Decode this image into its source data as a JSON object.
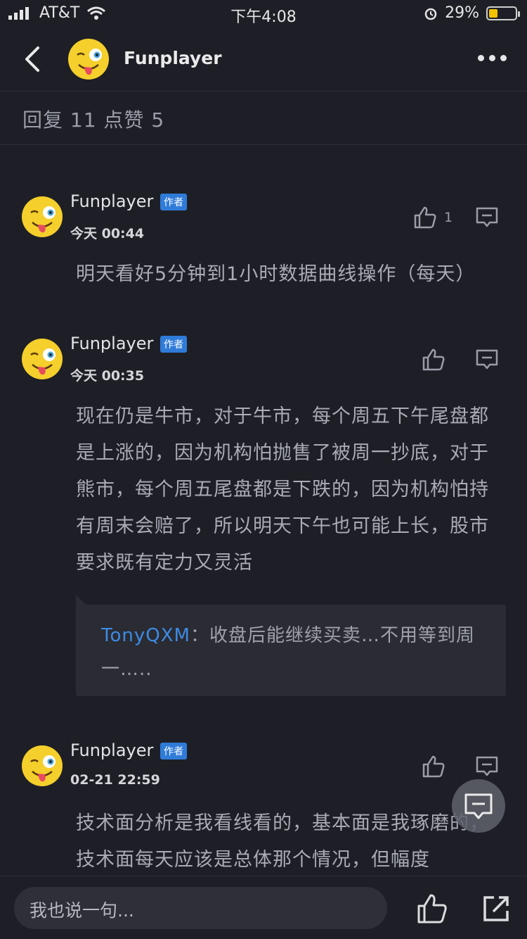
{
  "status_bar": {
    "carrier": "AT&T",
    "time": "下午4:08",
    "battery": "29%"
  },
  "nav": {
    "title": "Funplayer"
  },
  "stats": {
    "text": "回复 11  点赞 5"
  },
  "posts": [
    {
      "author": "Funplayer",
      "badge": "作者",
      "time": "今天 00:44",
      "likes": "1",
      "content": "明天看好5分钟到1小时数据曲线操作（每天）"
    },
    {
      "author": "Funplayer",
      "badge": "作者",
      "time": "今天 00:35",
      "likes": "",
      "content": "现在仍是牛市，对于牛市，每个周五下午尾盘都是上涨的，因为机构怕抛售了被周一抄底，对于熊市，每个周五尾盘都是下跌的，因为机构怕持有周末会赔了，所以明天下午也可能上长，股市要求既有定力又灵活",
      "quote": {
        "user": "TonyQXM",
        "separator": "：",
        "text": "收盘后能继续买卖…不用等到周一….."
      }
    },
    {
      "author": "Funplayer",
      "badge": "作者",
      "time": "02-21 22:59",
      "likes": "",
      "content": "技术面分析是我看线看的，基本面是我琢磨的，技术面每天应该是总体那个情况，但幅度"
    }
  ],
  "bottom_bar": {
    "placeholder": "我也说一句..."
  },
  "colors": {
    "background": "#1e1f26",
    "accent": "#2f7bd8",
    "quote_user": "#3d8be3"
  }
}
